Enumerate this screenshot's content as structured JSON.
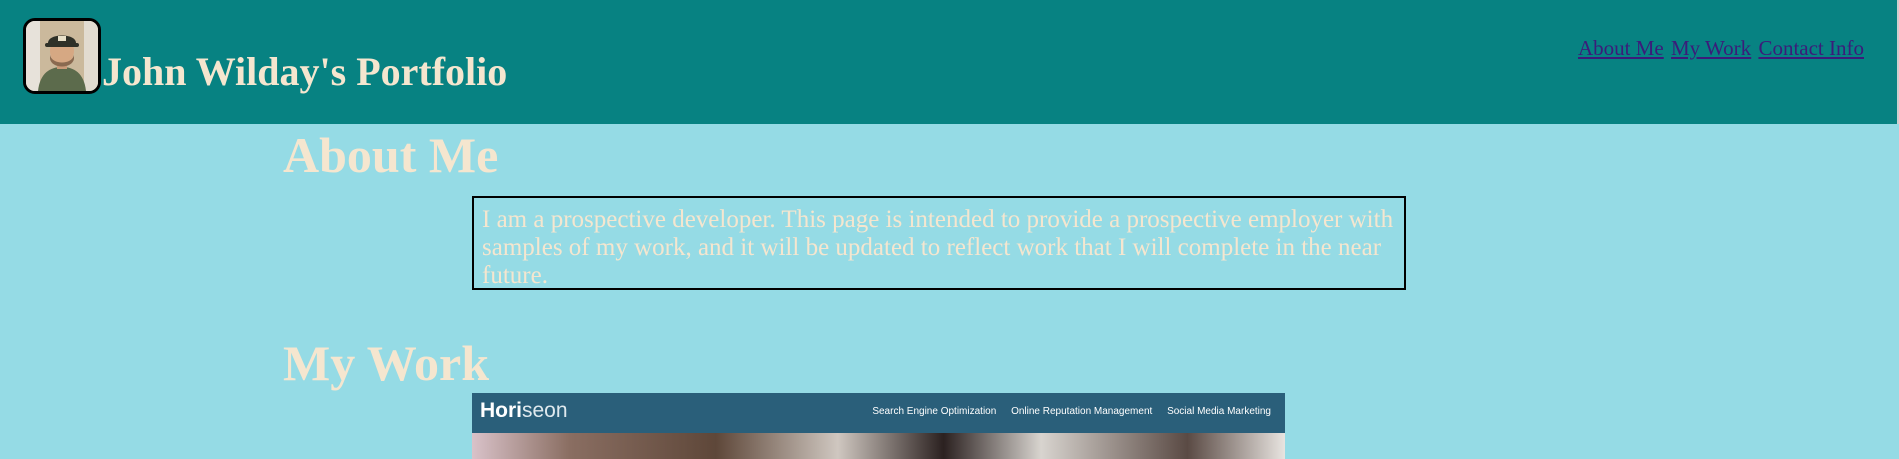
{
  "header": {
    "title": "John Wilday's Portfolio",
    "avatar_alt": "profile-photo",
    "nav": [
      {
        "label": "About Me"
      },
      {
        "label": "My Work"
      },
      {
        "label": "Contact Info"
      }
    ]
  },
  "about": {
    "heading": "About Me",
    "text": "I am a prospective developer. This page is intended to provide a prospective employer with samples of my work, and it will be updated to reflect work that I will complete in the near future."
  },
  "work": {
    "heading": "My Work",
    "screenshot": {
      "brand_bold": "Hori",
      "brand_light": "seon",
      "links": [
        "Search Engine Optimization",
        "Online Reputation Management",
        "Social Media Marketing"
      ]
    }
  },
  "colors": {
    "header_bg": "#078282",
    "page_bg": "#95dbe5",
    "heading_text": "#f5e6cf",
    "nav_link": "#3b1c7a"
  }
}
